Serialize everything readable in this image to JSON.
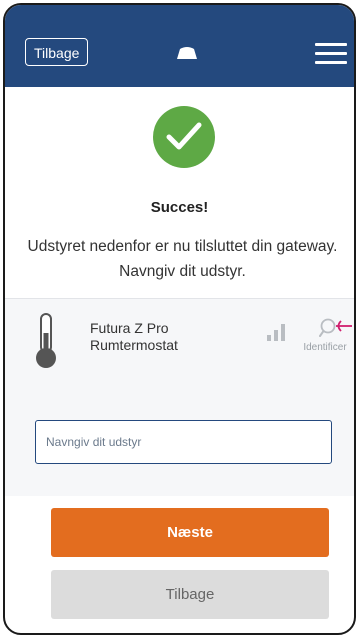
{
  "header": {
    "back_label": "Tilbage",
    "logo_icon": "gateway-icon",
    "menu_icon": "hamburger-menu-icon",
    "background_color": "#24497e"
  },
  "success": {
    "icon": "checkmark-icon",
    "icon_color": "#5ea945",
    "title": "Succes!",
    "message": "Udstyret nedenfor er nu tilsluttet din gateway. Navngiv dit udstyr."
  },
  "device": {
    "icon": "thermometer-icon",
    "name": "Futura Z Pro Rumtermostat",
    "signal_icon": "signal-strength-icon",
    "identify_icon": "search-icon",
    "identify_label": "Identificer",
    "input_placeholder": "Navngiv dit udstyr",
    "input_value": ""
  },
  "actions": {
    "next_label": "Næste",
    "next_color": "#e36d1f",
    "back_label": "Tilbage"
  }
}
